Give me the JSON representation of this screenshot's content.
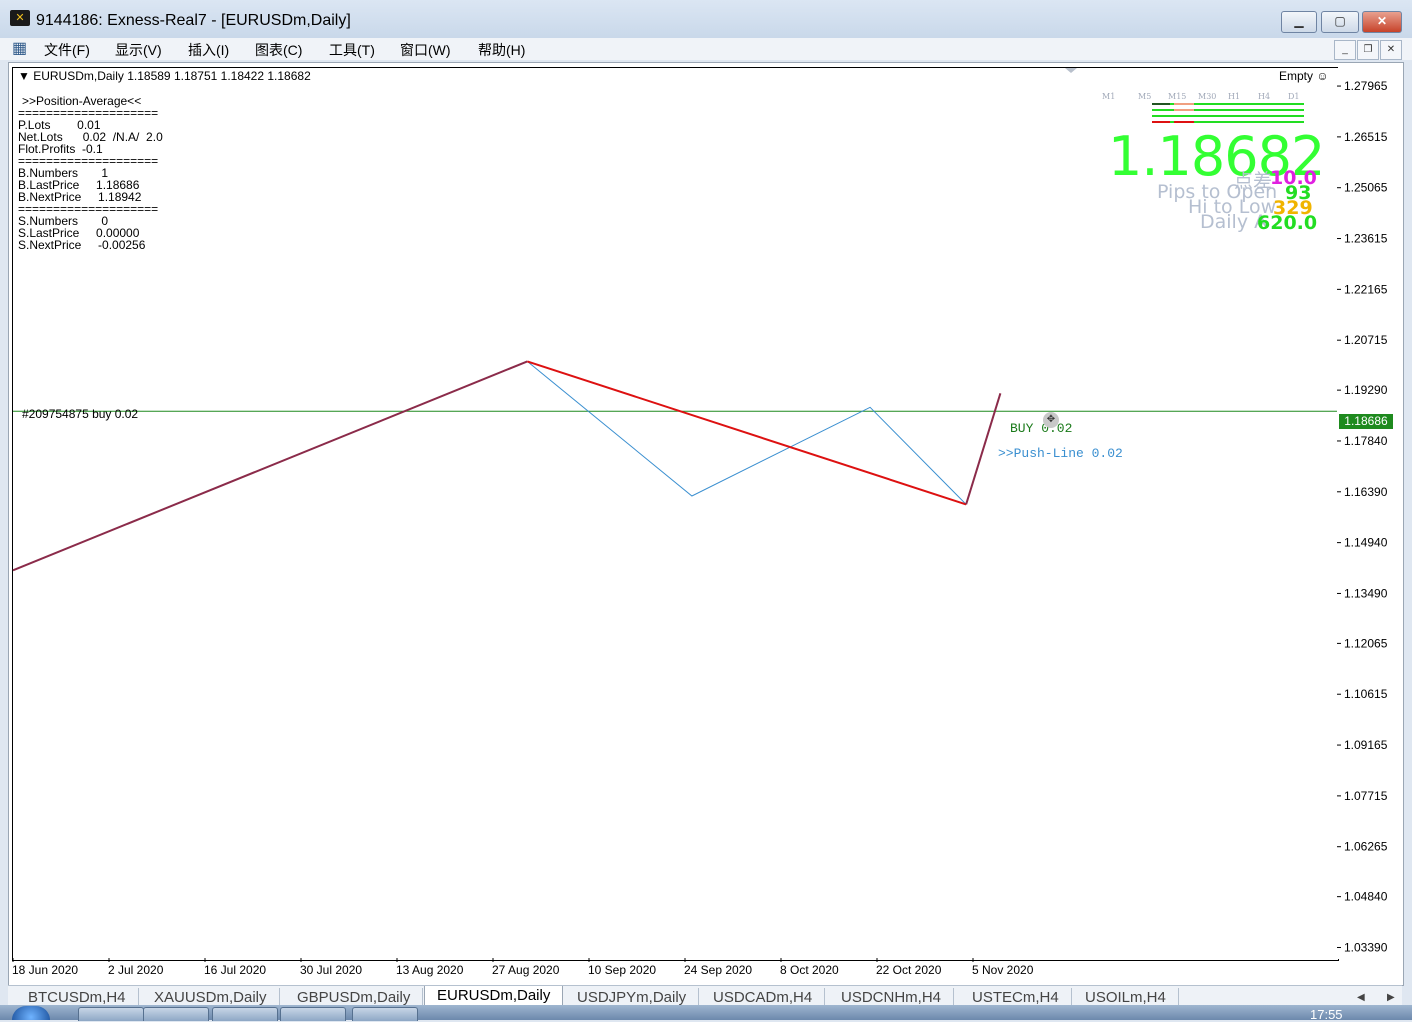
{
  "window": {
    "title": "9144186: Exness-Real7 - [EURUSDm,Daily]",
    "app_icon": "metatrader-icon",
    "buttons": [
      "minimize-icon",
      "maximize-icon",
      "close-icon"
    ]
  },
  "menu": {
    "items": [
      "文件(F)",
      "显示(V)",
      "插入(I)",
      "图表(C)",
      "工具(T)",
      "窗口(W)",
      "帮助(H)"
    ]
  },
  "chart_header": {
    "symbol_line": "EURUSDm,Daily  1.18589 1.18751 1.18422 1.18682",
    "empty_label": "Empty ☺"
  },
  "position_panel": {
    "title": ">>Position-Average<<",
    "separator": "====================",
    "p_lots": "P.Lots        0.01",
    "net_lots": "Net.Lots      0.02  /N.A/  2.0",
    "flot_profits": "Flot.Profits  -0.1",
    "b_numbers": "B.Numbers       1",
    "b_lastprice": "B.LastPrice     1.18686",
    "b_nextprice": "B.NextPrice     1.18942",
    "s_numbers": "S.Numbers       0",
    "s_lastprice": "S.LastPrice     0.00000",
    "s_nextprice": "S.NextPrice     -0.00256"
  },
  "dashboard": {
    "timeframes": [
      "M1",
      "M5",
      "M15",
      "M30",
      "H1",
      "H4",
      "D1"
    ],
    "price": "1.18682",
    "spread_label": "点差",
    "spread_value": "10.0",
    "pips_label": "Pips to Open",
    "pips_value": "93",
    "hilo_label": "Hi to Low",
    "hilo_value": "329",
    "daily_label": "Daily A",
    "daily_value": "620.0",
    "colors": {
      "price": "#33ff33",
      "spread": "#e020e0",
      "pips": "#22dd22",
      "hilo": "#f0b400",
      "daily": "#22dd22"
    }
  },
  "annotations": {
    "order_label": "#209754875 buy 0.02",
    "buy_label": "BUY 0.02",
    "push_label": ">>Push-Line 0.02",
    "current_price_tag": "1.18686"
  },
  "chart_data": {
    "type": "line",
    "y_tick_labels": [
      "1.27965",
      "1.26515",
      "1.25065",
      "1.23615",
      "1.22165",
      "1.20715",
      "1.19290",
      "1.17840",
      "1.16390",
      "1.14940",
      "1.13490",
      "1.12065",
      "1.10615",
      "1.09165",
      "1.07715",
      "1.06265",
      "1.04840",
      "1.03390"
    ],
    "x_tick_labels": [
      "18 Jun 2020",
      "2 Jul 2020",
      "16 Jul 2020",
      "30 Jul 2020",
      "13 Aug 2020",
      "27 Aug 2020",
      "10 Sep 2020",
      "24 Sep 2020",
      "8 Oct 2020",
      "22 Oct 2020",
      "5 Nov 2020"
    ],
    "ylim": [
      1.0309,
      1.2848
    ],
    "series": [
      {
        "color": "#8b2b4a",
        "points": [
          [
            "2020-06-18",
            1.1415
          ],
          [
            "2020-09-01",
            1.2011
          ]
        ]
      },
      {
        "color": "#3a8fd0",
        "points": [
          [
            "2020-09-01",
            1.2011
          ],
          [
            "2020-09-25",
            1.1627
          ],
          [
            "2020-10-21",
            1.188
          ],
          [
            "2020-11-04",
            1.1603
          ]
        ]
      },
      {
        "color": "#dd1111",
        "points": [
          [
            "2020-09-01",
            1.2011
          ],
          [
            "2020-11-04",
            1.1603
          ]
        ]
      },
      {
        "color": "#8b2b4a",
        "points": [
          [
            "2020-11-04",
            1.1603
          ],
          [
            "2020-11-09",
            1.192
          ]
        ]
      }
    ],
    "hline": {
      "value": 1.18686,
      "color": "#1e8a1e"
    }
  },
  "tabs": [
    "BTCUSDm,H4",
    "XAUUSDm,Daily",
    "GBPUSDm,Daily",
    "EURUSDm,Daily",
    "USDJPYm,Daily",
    "USDCADm,H4",
    "USDCNHm,H4",
    "USTECm,H4",
    "USOILm,H4"
  ],
  "active_tab": "EURUSDm,Daily",
  "taskbar": {
    "clock": "17:55"
  }
}
